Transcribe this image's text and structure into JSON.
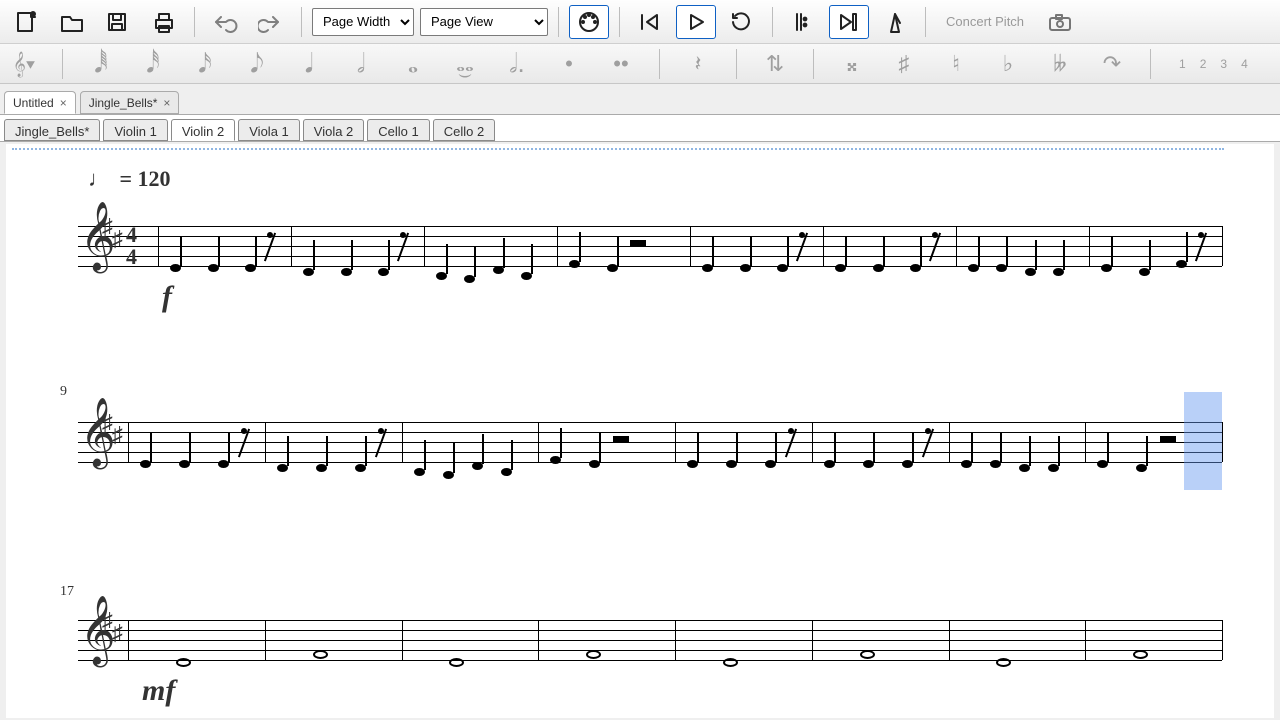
{
  "toolbar": {
    "zoomSelect": "Page Width",
    "viewSelect": "Page View",
    "concert": "Concert Pitch"
  },
  "voices": [
    "1",
    "2",
    "3",
    "4"
  ],
  "docTabs": [
    {
      "label": "Untitled",
      "active": true
    },
    {
      "label": "Jingle_Bells*",
      "active": false
    }
  ],
  "partTabs": [
    {
      "label": "Jingle_Bells*"
    },
    {
      "label": "Violin 1"
    },
    {
      "label": "Violin 2",
      "active": true
    },
    {
      "label": "Viola 1"
    },
    {
      "label": "Viola 2"
    },
    {
      "label": "Cello 1"
    },
    {
      "label": "Cello 2"
    }
  ],
  "score": {
    "tempoText": " = 120",
    "dynamic1": "f",
    "dynamic3": "mf",
    "measureNum2": "9",
    "measureNum3": "17",
    "timeSigNum": "4",
    "timeSigDen": "4",
    "keySharps": 2
  }
}
